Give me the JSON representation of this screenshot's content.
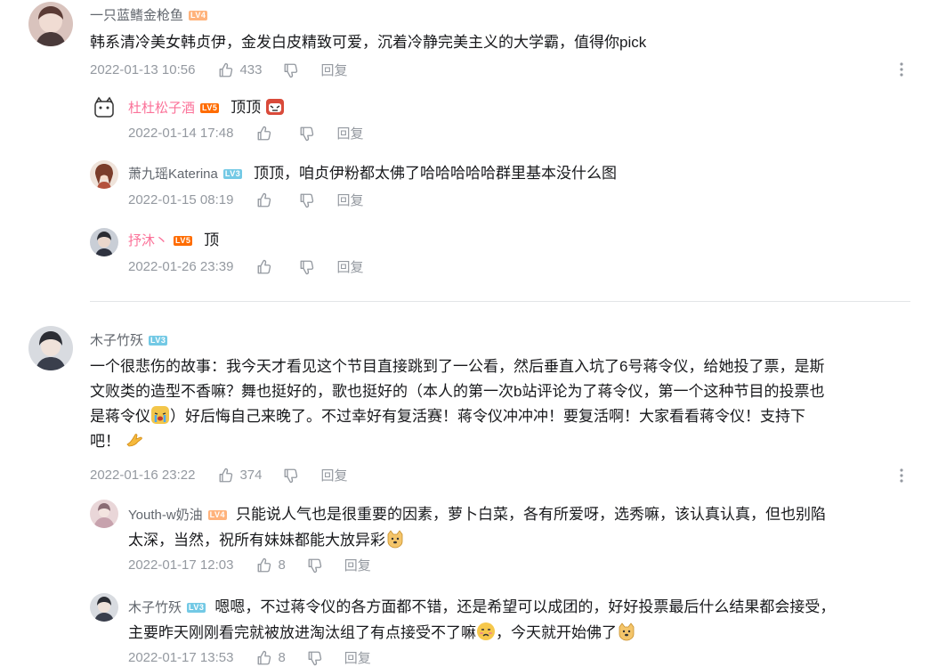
{
  "comments": [
    {
      "user": "一只蓝鳍金枪鱼",
      "level": "LV4",
      "text": "韩系清冷美女韩贞伊，金发白皮精致可爱，沉着冷静完美主义的大学霸，值得你pick",
      "time": "2022-01-13 10:56",
      "likes": "433",
      "reply": "回复",
      "replies": [
        {
          "user": "杜杜松子酒",
          "level": "LV5",
          "text": "顶顶",
          "time": "2022-01-14 17:48",
          "reply": "回复"
        },
        {
          "user": "萧九瑶Katerina",
          "level": "LV3",
          "text": "顶顶，咱贞伊粉都太佛了哈哈哈哈哈群里基本没什么图",
          "time": "2022-01-15 08:19",
          "reply": "回复"
        },
        {
          "user": "抒沐丶",
          "level": "LV5",
          "text": "顶",
          "time": "2022-01-26 23:39",
          "reply": "回复"
        }
      ]
    },
    {
      "user": "木子竹殀",
      "level": "LV3",
      "text_line1": "一个很悲伤的故事：我今天才看见这个节目直接跳到了一公看，然后垂直入坑了6号蒋令仪，给她投了票，是斯",
      "text_line2": "文败类的造型不香嘛？舞也挺好的，歌也挺好的（本人的第一次b站评论为了蒋令仪，第一个这种节目的投票也",
      "text_line3a": "是蒋令仪",
      "text_line3b": "）好后悔自己来晚了。不过幸好有复活赛！蒋令仪冲冲冲！要复活啊！大家看看蒋令仪！支持下",
      "text_line4": "吧！",
      "time": "2022-01-16 23:22",
      "likes": "374",
      "reply": "回复",
      "replies": [
        {
          "user": "Youth-w奶油",
          "level": "LV4",
          "text_line1": "只能说人气也是很重要的因素，萝卜白菜，各有所爱呀，选秀嘛，该认真认真，但也别陷",
          "text_line2": "太深，当然，祝所有妹妹都能大放异彩",
          "time": "2022-01-17 12:03",
          "likes": "8",
          "reply": "回复"
        },
        {
          "user": "木子竹殀",
          "level": "LV3",
          "text_line1": "嗯嗯，不过蒋令仪的各方面都不错，还是希望可以成团的，好好投票最后什么结果都会接受，",
          "text_line2a": "主要昨天刚刚看完就被放进淘汰组了有点接受不了嘛",
          "text_line2b": "，今天就开始佛了",
          "time": "2022-01-17 13:53",
          "likes": "8",
          "reply": "回复"
        }
      ]
    }
  ],
  "icons": {
    "like": "thumbs-up-icon",
    "dislike": "thumbs-down-icon",
    "more": "more-vertical-icon"
  },
  "colors": {
    "pink_name": "#fb7299",
    "meta": "#9499a0",
    "lv3": "#73c9e5",
    "lv4": "#ffb37c",
    "lv5": "#ff6c00"
  }
}
